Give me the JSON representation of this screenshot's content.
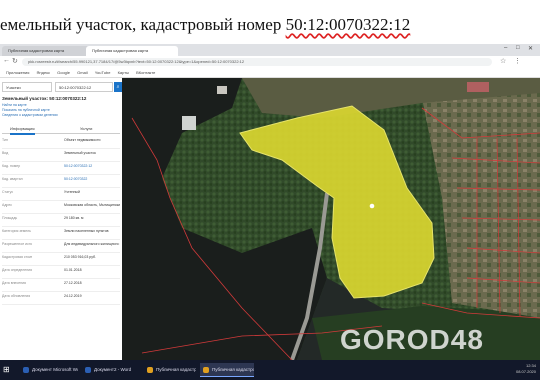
{
  "heading": {
    "prefix": "емельный участок, кадастровый номер ",
    "cadastral": "50:12:0070322:12"
  },
  "browser": {
    "tabs": [
      "Публичная кадастровая карта",
      "Публичная кадастровая карта"
    ],
    "url": "pkk.rosreestr.ru/#/search/55.990121,37.7184/17/@5w3tqxnb?text=50:12:0070322:12&type=1&opened=50:12:0070322:12",
    "bookmarks": [
      "Приложения",
      "Яндекс",
      "Google",
      "Gmail",
      "YouTube",
      "Карты",
      "ВКонтакте"
    ]
  },
  "sidebar": {
    "type_select": "Участки",
    "search_value": "50:12:0070322:12",
    "title": "Земельный участок: 50:12:0070322:12",
    "links": [
      "Найти на карте",
      "Показать на публичной карте",
      "Сведения о кадастровом делении"
    ],
    "tabs": [
      "Информация",
      "Услуги"
    ],
    "rows": [
      {
        "k": "Тип",
        "v": "Объект недвижимости"
      },
      {
        "k": "Вид",
        "v": "Земельный участок"
      },
      {
        "k": "Кад. номер",
        "v": "50:12:0070322:12"
      },
      {
        "k": "Кад. квартал",
        "v": "50:12:0070322"
      },
      {
        "k": "Статус",
        "v": "Учтенный"
      },
      {
        "k": "Адрес",
        "v": "Московская область, Мытищинский район, д. Чиверево"
      },
      {
        "k": "Площадь",
        "v": "29 180 кв. м"
      },
      {
        "k": "Категория земель",
        "v": "Земли населенных пунктов"
      },
      {
        "k": "Разрешенное использование",
        "v": "Для индивидуального жилищного строительства"
      },
      {
        "k": "Кадастровая стоимость",
        "v": "210 053 916,03 руб."
      },
      {
        "k": "Дата определения",
        "v": "01.01.2018"
      },
      {
        "k": "Дата внесения",
        "v": "27.12.2018"
      },
      {
        "k": "Дата обновления",
        "v": "24.12.2019"
      }
    ]
  },
  "taskbar": {
    "items": [
      "Документ Microsoft Word",
      "Документ2 - Word",
      "Публичная кадастровая карта",
      "Публичная кадастровая карта"
    ],
    "time": "12:34",
    "date": "08.07.2020"
  },
  "watermark": "GOROD48",
  "colors": {
    "parcel": "#d9d630",
    "boundary": "#d23a3a",
    "water": "#1a1e1c",
    "forest": "#3a5530"
  }
}
